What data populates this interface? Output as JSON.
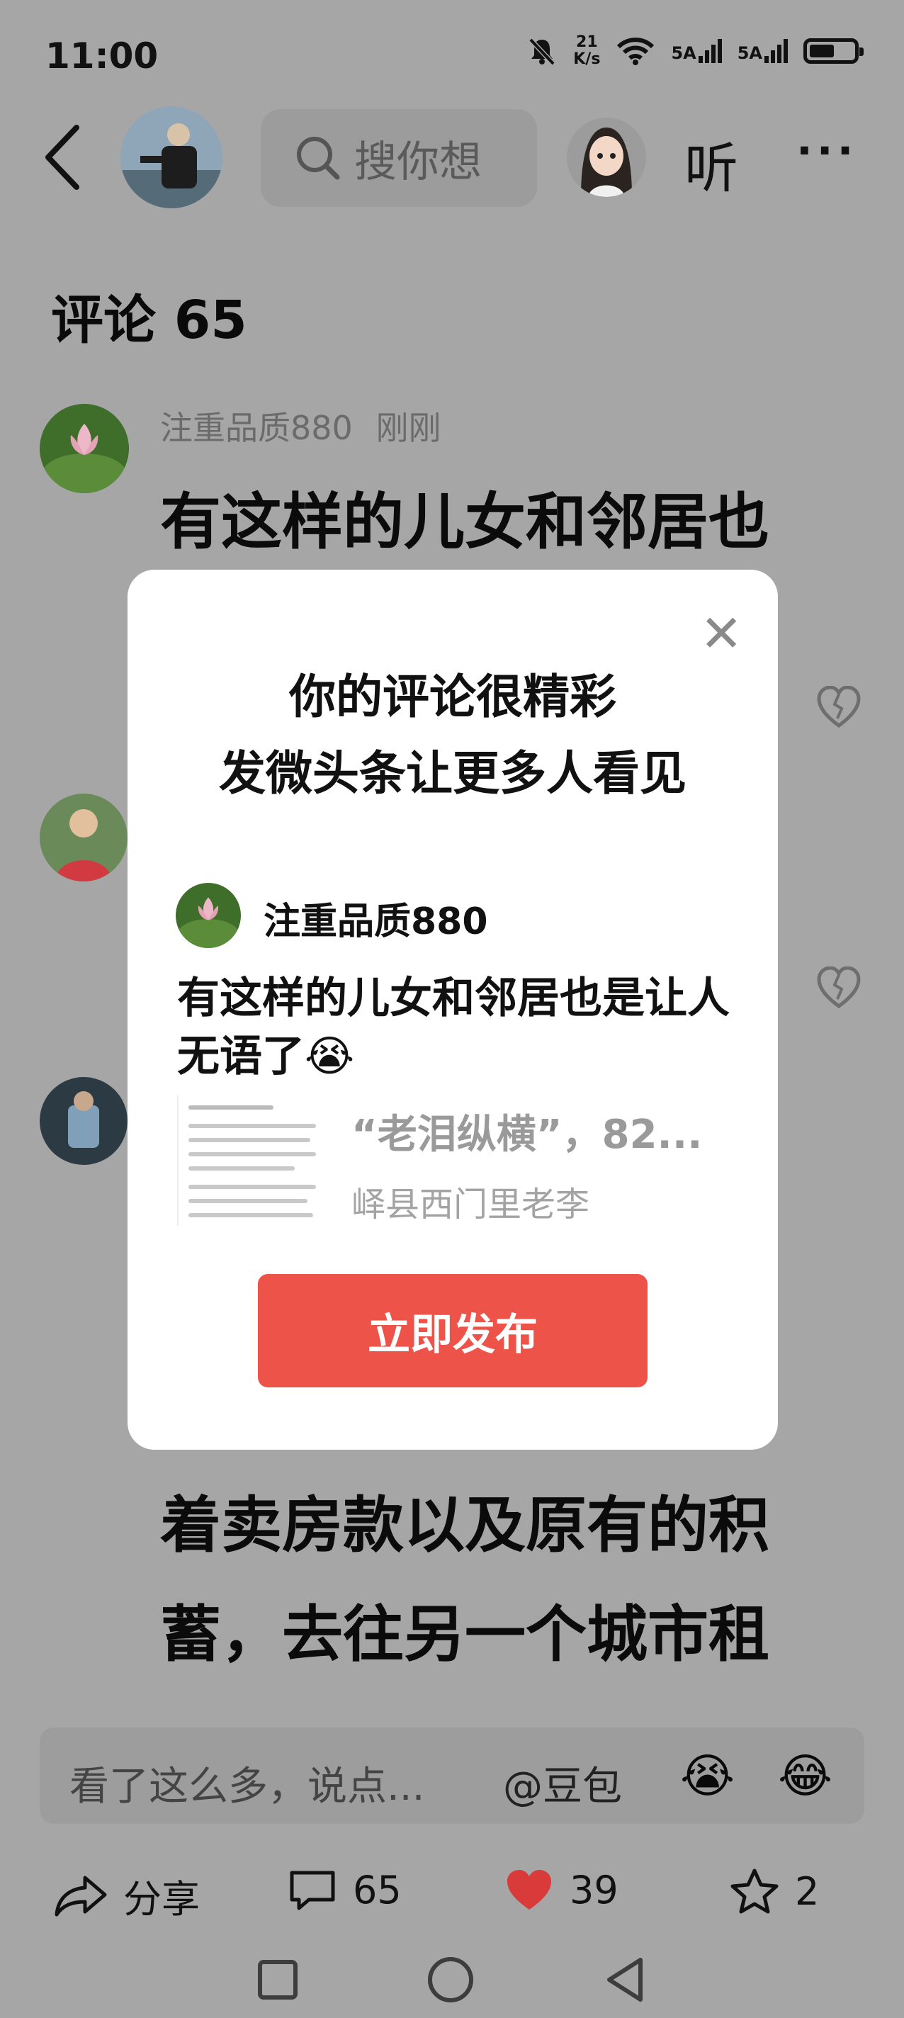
{
  "status_bar": {
    "time": "11:00",
    "net_speed_value": "21",
    "net_speed_unit": "K/s",
    "signal_1": "5A",
    "signal_2": "5A"
  },
  "header": {
    "search_placeholder": "搜你想",
    "listen_label": "听",
    "more_label": "···"
  },
  "comments": {
    "title": "评论 65",
    "items": [
      {
        "user": "注重品质880",
        "time": "刚刚",
        "text": "有这样的儿女和邻居也"
      }
    ],
    "background_lines": [
      "着卖房款以及原有的积",
      "蓄，去往另一个城市租"
    ]
  },
  "modal": {
    "title_line1": "你的评论很精彩",
    "title_line2": "发微头条让更多人看见",
    "user": "注重品质880",
    "comment": "有这样的儿女和邻居也是让人无语了😭",
    "card_title": "“老泪纵横”，82...",
    "card_author": "峄县西门里老李",
    "publish_button": "立即发布"
  },
  "input_bar": {
    "placeholder": "看了这么多，说点...",
    "mention": "@豆包",
    "emoji_1": "😭",
    "emoji_2": "😂"
  },
  "actions": {
    "share_label": "分享",
    "comment_count": "65",
    "like_count": "39",
    "favorite_count": "2"
  },
  "colors": {
    "accent_red": "#ee5349",
    "like_heart": "#d93a3a"
  },
  "icons": [
    "back-icon",
    "search-icon",
    "close-icon",
    "broken-heart-icon",
    "share-icon",
    "comment-icon",
    "heart-icon",
    "star-icon"
  ]
}
